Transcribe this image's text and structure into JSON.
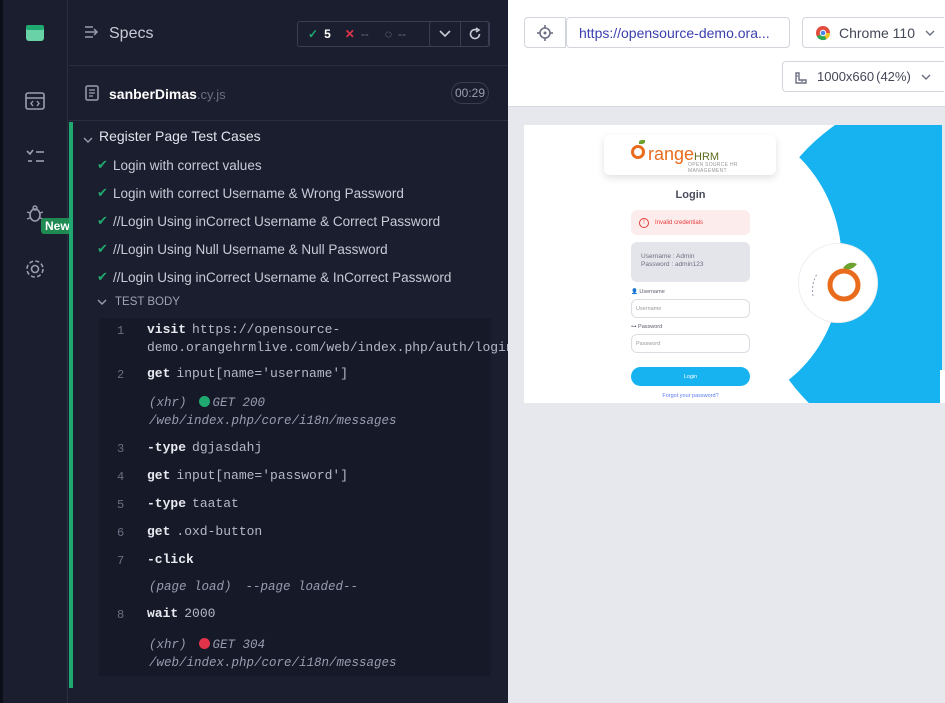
{
  "sidebar": {
    "new_badge": "New"
  },
  "header": {
    "title": "Specs",
    "stats": {
      "passed": "5",
      "failed": "--",
      "pending": "--"
    }
  },
  "spec": {
    "file_name": "sanberDimas",
    "file_ext": ".cy.js",
    "duration": "00:29"
  },
  "suite": {
    "title": "Register Page Test Cases",
    "tests": [
      "Login with correct values",
      "Login with correct Username & Wrong Password",
      "//Login Using inCorrect Username & Correct Password",
      "//Login Using Null Username & Null Password",
      "//Login Using inCorrect Username & InCorrect Password"
    ],
    "body_label": "TEST BODY"
  },
  "log": [
    {
      "n": "1",
      "cmd": "visit",
      "arg": "https://opensource-",
      "arg2": "demo.orangehrmlive.com/web/index.php/auth/login"
    },
    {
      "n": "2",
      "cmd": "get",
      "arg": "input[name='username']"
    },
    {
      "kind": "(xhr)",
      "status": "GET 200",
      "path": "/web/index.php/core/i18n/messages",
      "color": "#1fa971"
    },
    {
      "n": "3",
      "cmd": "-type",
      "arg": "dgjasdahj"
    },
    {
      "n": "4",
      "cmd": "get",
      "arg": "input[name='password']"
    },
    {
      "n": "5",
      "cmd": "-type",
      "arg": "taatat"
    },
    {
      "n": "6",
      "cmd": "get",
      "arg": ".oxd-button"
    },
    {
      "n": "7",
      "cmd": "-click",
      "arg": ""
    },
    {
      "kind": "(page load)",
      "status": "--page loaded--"
    },
    {
      "n": "8",
      "cmd": "wait",
      "arg": "2000"
    },
    {
      "kind": "(xhr)",
      "status": "GET 304",
      "path": "/web/index.php/core/i18n/messages",
      "color": "#e0344a"
    }
  ],
  "browser_bar": {
    "url": "https://opensource-demo.ora...",
    "browser": "Chrome 110",
    "viewport": "1000x660",
    "zoom": "(42%)"
  },
  "aut": {
    "logo_main": "range",
    "logo_hrm": "HRM",
    "logo_sub": "OPEN SOURCE HR MANAGEMENT",
    "title": "Login",
    "alert": "Invalid credentials",
    "cred_user": "Username : Admin",
    "cred_pass": "Password : admin123",
    "username_label": "Username",
    "username_placeholder": "Username",
    "password_label": "Password",
    "password_placeholder": "Password",
    "login_button": "Login",
    "forgot": "Forgot your password?"
  }
}
